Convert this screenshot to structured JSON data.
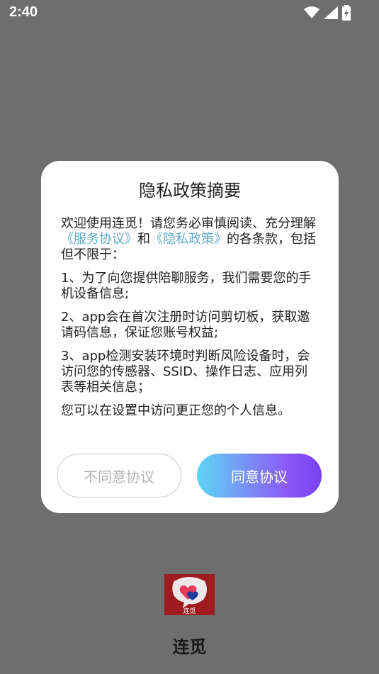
{
  "status_bar": {
    "time": "2:40",
    "icons": [
      "wifi-icon",
      "signal-icon",
      "battery-charging-icon"
    ]
  },
  "dialog": {
    "title": "隐私政策摘要",
    "intro_prefix": "欢迎使用连觅！请您务必审慎阅读、充分理解",
    "link_service": "《服务协议》",
    "intro_and": "和",
    "link_privacy": "《隐私政策》",
    "intro_suffix": "的各条款，包括但不限于：",
    "items": [
      "1、为了向您提供陪聊服务，我们需要您的手机设备信息;",
      "2、app会在首次注册时访问剪切板，获取邀请码信息，保证您账号权益;",
      "3、app检测安装环境时判断风险设备时，会访问您的传感器、SSID、操作日志、应用列表等相关信息；"
    ],
    "footer_note": "您可以在设置中访问更正您的个人信息。",
    "decline_label": "不同意协议",
    "agree_label": "同意协议"
  },
  "splash": {
    "logo_text": "连觅",
    "app_name": "连觅"
  },
  "colors": {
    "overlay": "#6e6e6e",
    "link": "#64aac8",
    "agree_gradient_start": "#5ed6f4",
    "agree_gradient_end": "#7b3ff2",
    "logo_bg": "#9e1b1f"
  }
}
